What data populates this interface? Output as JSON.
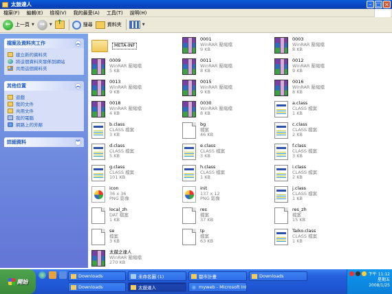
{
  "window": {
    "title": "太鼓達人"
  },
  "menu": [
    "檔案(F)",
    "編輯(E)",
    "檢視(V)",
    "我的最愛(A)",
    "工具(T)",
    "說明(H)"
  ],
  "toolbar": {
    "back_label": "上一頁",
    "search_label": "搜尋",
    "folders_label": "資料夾"
  },
  "left_panel": {
    "tasks": {
      "title": "檔案及資料夾工作",
      "items": [
        "建立新的資料夾",
        "將這個資料夾發佈到網站",
        "共用這個資料夾"
      ]
    },
    "places": {
      "title": "其他位置",
      "items": [
        "遊戲",
        "我的文件",
        "共用文件",
        "我的電腦",
        "網路上的芳鄰"
      ]
    },
    "details": {
      "title": "詳細資料"
    }
  },
  "files": [
    {
      "name": "META-INF",
      "type": "",
      "size": "",
      "icon": "folder"
    },
    {
      "name": "0001",
      "type": "WinRAR 壓縮檔",
      "size": "9 KB",
      "icon": "rar"
    },
    {
      "name": "0003",
      "type": "WinRAR 壓縮檔",
      "size": "8 KB",
      "icon": "rar"
    },
    {
      "name": "0009",
      "type": "WinRAR 壓縮檔",
      "size": "5 KB",
      "icon": "rar"
    },
    {
      "name": "0011",
      "type": "WinRAR 壓縮檔",
      "size": "8 KB",
      "icon": "rar"
    },
    {
      "name": "0012",
      "type": "WinRAR 壓縮檔",
      "size": "9 KB",
      "icon": "rar"
    },
    {
      "name": "0013",
      "type": "WinRAR 壓縮檔",
      "size": "9 KB",
      "icon": "rar"
    },
    {
      "name": "0015",
      "type": "WinRAR 壓縮檔",
      "size": "9 KB",
      "icon": "rar"
    },
    {
      "name": "0016",
      "type": "WinRAR 壓縮檔",
      "size": "8 KB",
      "icon": "rar"
    },
    {
      "name": "0018",
      "type": "WinRAR 壓縮檔",
      "size": "4 KB",
      "icon": "rar"
    },
    {
      "name": "0030",
      "type": "WinRAR 壓縮檔",
      "size": "8 KB",
      "icon": "rar"
    },
    {
      "name": "a.class",
      "type": "CLASS 檔案",
      "size": "1 KB",
      "icon": "cls"
    },
    {
      "name": "b.class",
      "type": "CLASS 檔案",
      "size": "3 KB",
      "icon": "cls"
    },
    {
      "name": "bg",
      "type": "檔案",
      "size": "46 KB",
      "icon": "blank"
    },
    {
      "name": "c.class",
      "type": "CLASS 檔案",
      "size": "2 KB",
      "icon": "cls"
    },
    {
      "name": "d.class",
      "type": "CLASS 檔案",
      "size": "5 KB",
      "icon": "cls"
    },
    {
      "name": "e.class",
      "type": "CLASS 檔案",
      "size": "3 KB",
      "icon": "cls"
    },
    {
      "name": "f.class",
      "type": "CLASS 檔案",
      "size": "3 KB",
      "icon": "cls"
    },
    {
      "name": "g.class",
      "type": "CLASS 檔案",
      "size": "101 KB",
      "icon": "cls"
    },
    {
      "name": "h.class",
      "type": "CLASS 檔案",
      "size": "1 KB",
      "icon": "cls"
    },
    {
      "name": "i.class",
      "type": "CLASS 檔案",
      "size": "2 KB",
      "icon": "cls"
    },
    {
      "name": "icon",
      "type": "36 x 36",
      "size": "PNG 影像",
      "icon": "png"
    },
    {
      "name": "init",
      "type": "137 x 12",
      "size": "PNG 影像",
      "icon": "png"
    },
    {
      "name": "j.class",
      "type": "CLASS 檔案",
      "size": "1 KB",
      "icon": "cls"
    },
    {
      "name": "local_zh",
      "type": "DAT 檔案",
      "size": "1 KB",
      "icon": "blank"
    },
    {
      "name": "res",
      "type": "檔案",
      "size": "37 KB",
      "icon": "blank"
    },
    {
      "name": "res_zh",
      "type": "檔案",
      "size": "15 KB",
      "icon": "blank"
    },
    {
      "name": "se",
      "type": "檔案",
      "size": "3 KB",
      "icon": "blank"
    },
    {
      "name": "tp",
      "type": "檔案",
      "size": "63 KB",
      "icon": "blank"
    },
    {
      "name": "Taiko.class",
      "type": "CLASS 檔案",
      "size": "1 KB",
      "icon": "cls"
    },
    {
      "name": "太鼓之達人",
      "type": "WinRAR 壓縮檔",
      "size": "270 KB",
      "icon": "rar"
    }
  ],
  "taskbar": {
    "start_label": "開始",
    "row1": [
      "Downloads",
      "未命名圖 (1)",
      "都市計畫",
      "Downloads"
    ],
    "row2": [
      "Downloads",
      "太鼓達人",
      "myweb - Microsoft Int...",
      ""
    ],
    "clock": {
      "time": "下午 11:12",
      "day": "星期五",
      "date": "2008/1/25"
    }
  }
}
